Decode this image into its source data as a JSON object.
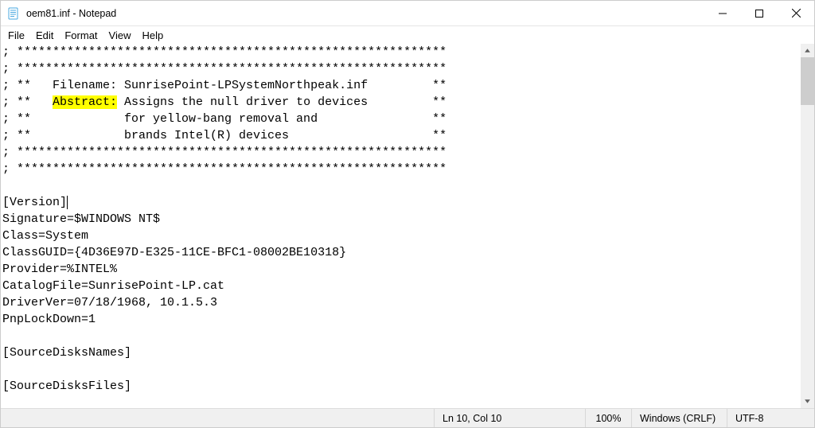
{
  "window": {
    "title": "oem81.inf - Notepad"
  },
  "menu": {
    "items": [
      "File",
      "Edit",
      "Format",
      "View",
      "Help"
    ]
  },
  "document": {
    "lines": [
      "; ************************************************************",
      "; ************************************************************",
      "; **   Filename: SunrisePoint-LPSystemNorthpeak.inf         **",
      "; **   Abstract: Assigns the null driver to devices         **",
      "; **             for yellow-bang removal and                **",
      "; **             brands Intel(R) devices                    **",
      "; ************************************************************",
      "; ************************************************************",
      "",
      "[Version]",
      "Signature=$WINDOWS NT$",
      "Class=System",
      "ClassGUID={4D36E97D-E325-11CE-BFC1-08002BE10318}",
      "Provider=%INTEL%",
      "CatalogFile=SunrisePoint-LP.cat",
      "DriverVer=07/18/1968, 10.1.5.3",
      "PnpLockDown=1",
      "",
      "[SourceDisksNames]",
      "",
      "[SourceDisksFiles]"
    ],
    "highlight": {
      "line_index": 3,
      "text": "Abstract:"
    },
    "caret_line": 9,
    "caret_after_text": "[Version]"
  },
  "status": {
    "position": "Ln 10, Col 10",
    "zoom": "100%",
    "line_ending": "Windows (CRLF)",
    "encoding": "UTF-8"
  }
}
